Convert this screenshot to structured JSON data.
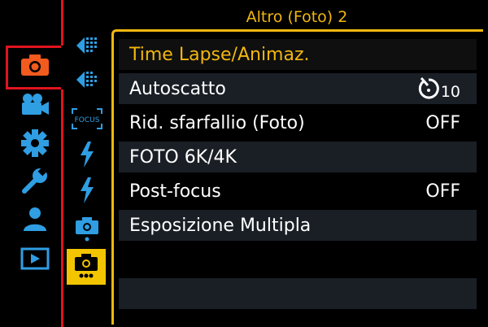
{
  "title": "Altro (Foto) 2",
  "menu": {
    "items": [
      {
        "label": "Time Lapse/Animaz.",
        "value": ""
      },
      {
        "label": "Autoscatto",
        "value": "10"
      },
      {
        "label": "Rid. sfarfallio (Foto)",
        "value": "OFF"
      },
      {
        "label": "FOTO 6K/4K",
        "value": ""
      },
      {
        "label": "Post-focus",
        "value": "OFF"
      },
      {
        "label": "Esposizione Multipla",
        "value": ""
      }
    ]
  },
  "sidebar": {
    "categories": [
      "camera-icon",
      "video-camera-icon",
      "gear-icon",
      "wrench-icon",
      "person-icon",
      "playback-icon"
    ],
    "sub_tabs": [
      "photo-style-icon",
      "photo-style-2-icon",
      "focus-icon",
      "flash-icon",
      "flash-2-icon",
      "photo-other-1-icon",
      "photo-other-2-icon"
    ],
    "focus_label": "FOCUS"
  },
  "colors": {
    "accent": "#f2b70e",
    "highlight": "#e0141f",
    "category": "#2f9ee3",
    "row_alt": "#1a1f26"
  }
}
